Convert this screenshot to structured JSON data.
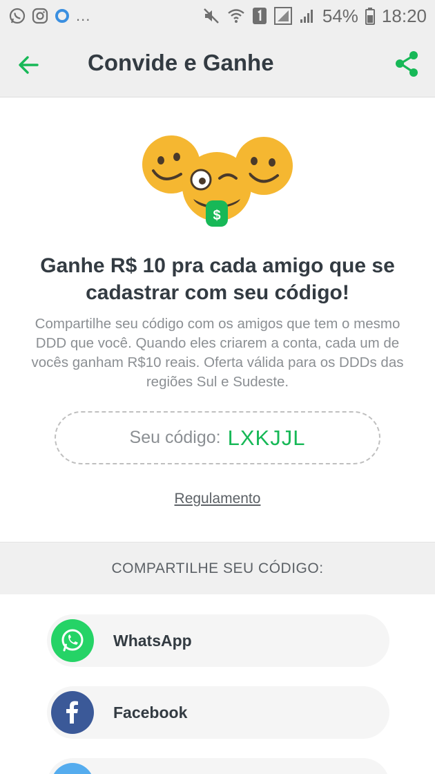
{
  "status_bar": {
    "more": "...",
    "battery": "54%",
    "time": "18:20"
  },
  "header": {
    "title": "Convide e Ganhe"
  },
  "hero": {
    "coin_symbol": "$"
  },
  "main": {
    "headline": "Ganhe R$ 10 pra cada amigo que se cadastrar com seu código!",
    "description": "Compartilhe seu código com os amigos que tem o mesmo DDD que você. Quando eles criarem a conta, cada um de vocês ganham R$10 reais. Oferta válida para os DDDs das regiões Sul e Sudeste.",
    "code_label": "Seu código:",
    "code_value": "LXKJJL",
    "regulamento": "Regulamento"
  },
  "share": {
    "header": "COMPARTILHE SEU CÓDIGO:",
    "items": [
      {
        "label": "WhatsApp",
        "icon": "whatsapp-icon",
        "color": "#25d366"
      },
      {
        "label": "Facebook",
        "icon": "facebook-icon",
        "color": "#3b5998"
      },
      {
        "label": "",
        "icon": "twitter-icon",
        "color": "#55acee"
      }
    ]
  },
  "colors": {
    "accent": "#17b857",
    "title_text": "#333b42",
    "body_text": "#8b8f93",
    "bar_background": "#efefef"
  }
}
